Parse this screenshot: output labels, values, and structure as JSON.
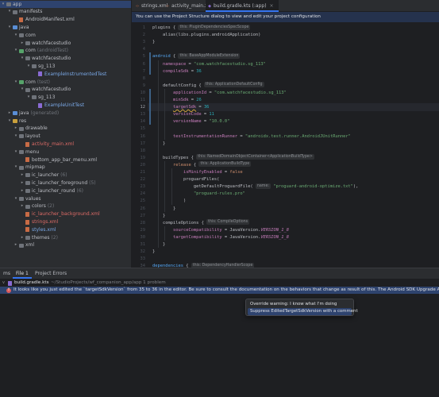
{
  "tree": [
    {
      "label": "app",
      "indent": 0,
      "chev": "v",
      "icon": "folder",
      "color": "plain",
      "selected": true
    },
    {
      "label": "manifests",
      "indent": 1,
      "chev": "v",
      "icon": "folder",
      "color": "plain"
    },
    {
      "label": "AndroidManifest.xml",
      "indent": 2,
      "chev": "",
      "icon": "file xml",
      "color": "plain"
    },
    {
      "label": "java",
      "indent": 1,
      "chev": "v",
      "icon": "folder src",
      "color": "plain"
    },
    {
      "label": "com",
      "indent": 2,
      "chev": "v",
      "icon": "folder",
      "color": "plain"
    },
    {
      "label": "watchfacestudio",
      "indent": 3,
      "chev": ">",
      "icon": "folder",
      "color": "plain"
    },
    {
      "label": "com",
      "note": "(androidTest)",
      "indent": 2,
      "chev": "v",
      "icon": "folder test",
      "color": "plain"
    },
    {
      "label": "watchfacestudio",
      "indent": 3,
      "chev": "v",
      "icon": "folder",
      "color": "plain"
    },
    {
      "label": "sg_113",
      "indent": 4,
      "chev": "v",
      "icon": "folder",
      "color": "plain"
    },
    {
      "label": "ExampleInstrumentedTest",
      "indent": 5,
      "chev": "",
      "icon": "file kt",
      "color": "blue"
    },
    {
      "label": "com",
      "note": "(test)",
      "indent": 2,
      "chev": "v",
      "icon": "folder test",
      "color": "plain"
    },
    {
      "label": "watchfacestudio",
      "indent": 3,
      "chev": "v",
      "icon": "folder",
      "color": "plain"
    },
    {
      "label": "sg_113",
      "indent": 4,
      "chev": "v",
      "icon": "folder",
      "color": "plain"
    },
    {
      "label": "ExampleUnitTest",
      "indent": 5,
      "chev": "",
      "icon": "file kt",
      "color": "blue"
    },
    {
      "label": "java",
      "note": "(generated)",
      "indent": 1,
      "chev": ">",
      "icon": "folder src",
      "color": "plain"
    },
    {
      "label": "res",
      "indent": 1,
      "chev": "v",
      "icon": "folder res",
      "color": "plain"
    },
    {
      "label": "drawable",
      "indent": 2,
      "chev": ">",
      "icon": "folder",
      "color": "plain"
    },
    {
      "label": "layout",
      "indent": 2,
      "chev": "v",
      "icon": "folder",
      "color": "plain"
    },
    {
      "label": "activity_main.xml",
      "indent": 3,
      "chev": "",
      "icon": "file xml",
      "color": "red"
    },
    {
      "label": "menu",
      "indent": 2,
      "chev": "v",
      "icon": "folder",
      "color": "plain"
    },
    {
      "label": "bottom_app_bar_menu.xml",
      "indent": 3,
      "chev": "",
      "icon": "file xml",
      "color": "plain"
    },
    {
      "label": "mipmap",
      "indent": 2,
      "chev": "v",
      "icon": "folder",
      "color": "plain"
    },
    {
      "label": "ic_launcher",
      "note": "(6)",
      "indent": 3,
      "chev": ">",
      "icon": "folder",
      "color": "plain"
    },
    {
      "label": "ic_launcher_foreground",
      "note": "(5)",
      "indent": 3,
      "chev": ">",
      "icon": "folder",
      "color": "plain"
    },
    {
      "label": "ic_launcher_round",
      "note": "(6)",
      "indent": 3,
      "chev": ">",
      "icon": "folder",
      "color": "plain"
    },
    {
      "label": "values",
      "indent": 2,
      "chev": "v",
      "icon": "folder",
      "color": "plain"
    },
    {
      "label": "colors",
      "note": "(2)",
      "indent": 3,
      "chev": ">",
      "icon": "folder",
      "color": "plain"
    },
    {
      "label": "ic_launcher_background.xml",
      "indent": 3,
      "chev": "",
      "icon": "file xml",
      "color": "red"
    },
    {
      "label": "strings.xml",
      "indent": 3,
      "chev": "",
      "icon": "file xml",
      "color": "red"
    },
    {
      "label": "styles.xml",
      "indent": 3,
      "chev": "",
      "icon": "file xml",
      "color": "blue"
    },
    {
      "label": "themes",
      "note": "(2)",
      "indent": 3,
      "chev": ">",
      "icon": "folder",
      "color": "plain"
    },
    {
      "label": "xml",
      "indent": 2,
      "chev": ">",
      "icon": "folder",
      "color": "plain"
    }
  ],
  "tabs": [
    {
      "label": "strings.xml",
      "kind": "xml",
      "active": false
    },
    {
      "label": "activity_main.xml",
      "kind": "xml",
      "active": false
    },
    {
      "label": "build.gradle.kts (:app)",
      "kind": "kts",
      "active": true
    }
  ],
  "banner": "You can use the Project Structure dialog to view and edit your project configuration",
  "code": [
    {
      "n": 1,
      "html": "plugins { <span class='hint'>this: PluginDependenciesSpecScope</span>"
    },
    {
      "n": 2,
      "html": "    alias(libs.plugins.androidApplication)"
    },
    {
      "n": 3,
      "html": "}"
    },
    {
      "n": 4,
      "html": ""
    },
    {
      "n": 5,
      "html": "<span class='fn'>android</span> { <span class='hint'>this: BaseAppModuleExtension</span>"
    },
    {
      "n": 6,
      "html": "    <span class='prop'>namespace</span> = <span class='str'>\"com.watchfacestudio.sg_113\"</span>"
    },
    {
      "n": 7,
      "html": "    <span class='prop'>compileSdk</span> = <span class='num'>36</span>"
    },
    {
      "n": 8,
      "html": ""
    },
    {
      "n": 9,
      "html": "    defaultConfig { <span class='hint'>this: ApplicationDefaultConfig</span>"
    },
    {
      "n": 10,
      "html": "        <span class='prop'>applicationId</span> = <span class='str'>\"com.watchfacestudio.sg_113\"</span>"
    },
    {
      "n": 11,
      "html": "        <span class='prop'>minSdk</span> = <span class='num'>26</span>"
    },
    {
      "n": 12,
      "html": "        <span class='prop warnu'>targetSdk</span> = <span class='num'>36</span>",
      "current": true
    },
    {
      "n": 13,
      "html": "        <span class='prop'>versionCode</span> = <span class='num'>11</span>"
    },
    {
      "n": 14,
      "html": "        <span class='prop'>versionName</span> = <span class='str'>\"10.0.0\"</span>"
    },
    {
      "n": 15,
      "html": ""
    },
    {
      "n": 16,
      "html": "        <span class='prop'>testInstrumentationRunner</span> = <span class='str'>\"androidx.test.runner.AndroidJUnitRunner\"</span>"
    },
    {
      "n": 17,
      "html": "    }"
    },
    {
      "n": 18,
      "html": ""
    },
    {
      "n": 19,
      "html": "    buildTypes { <span class='hint'>this: NamedDomainObjectContainer&lt;ApplicationBuildType&gt;</span>"
    },
    {
      "n": 20,
      "html": "        <span class='kw'>release</span> { <span class='hint'>this: ApplicationBuildType</span>"
    },
    {
      "n": 21,
      "html": "            <span class='prop'>isMinifyEnabled</span> = <span class='kw'>false</span>"
    },
    {
      "n": 22,
      "html": "            proguardFiles("
    },
    {
      "n": 23,
      "html": "                getDefaultProguardFile( <span class='hint'>name:</span> <span class='str'>\"proguard-android-optimize.txt\"</span>),"
    },
    {
      "n": 24,
      "html": "                <span class='str'>\"proguard-rules.pro\"</span>"
    },
    {
      "n": 25,
      "html": "            )"
    },
    {
      "n": 26,
      "html": "        }"
    },
    {
      "n": 27,
      "html": "    }"
    },
    {
      "n": 28,
      "html": "    compileOptions { <span class='hint'>this: CompileOptions</span>"
    },
    {
      "n": 29,
      "html": "        <span class='prop'>sourceCompatibility</span> = JavaVersion.<span class='prop'><i>VERSION_1_8</i></span>"
    },
    {
      "n": 30,
      "html": "        <span class='prop'>targetCompatibility</span> = JavaVersion.<span class='prop'><i>VERSION_1_8</i></span>"
    },
    {
      "n": 31,
      "html": "    }"
    },
    {
      "n": 32,
      "html": "}"
    },
    {
      "n": 33,
      "html": ""
    },
    {
      "n": 34,
      "html": "<span class='fn'>dependencies</span> { <span class='hint'>this: DependencyHandlerScope</span>"
    }
  ],
  "bottom": {
    "tabs": [
      {
        "label": "ms",
        "active": false
      },
      {
        "label": "File 1",
        "active": true
      },
      {
        "label": "Project Errors",
        "active": false
      }
    ],
    "file_name": "build.gradle.kts",
    "file_path": "~/StudioProjects/wf_companion_app/app  1 problem",
    "message": "It looks like you just edited the `targetSdkVersion` from 35 to 36 in the editor. Be sure to consult the documentation on the behaviors that change as result of this. The Android SDK Upgrade Assistant can help with saf"
  },
  "popup": {
    "items": [
      {
        "label": "Override warning: I know what I'm doing",
        "selected": false
      },
      {
        "label": "Suppress EditedTargetSdkVersion with a comment",
        "selected": true
      }
    ]
  },
  "colors": {
    "accent": "#3574f0",
    "selection": "#2e436e",
    "error": "#db5c5c",
    "banner": "#25324d"
  }
}
